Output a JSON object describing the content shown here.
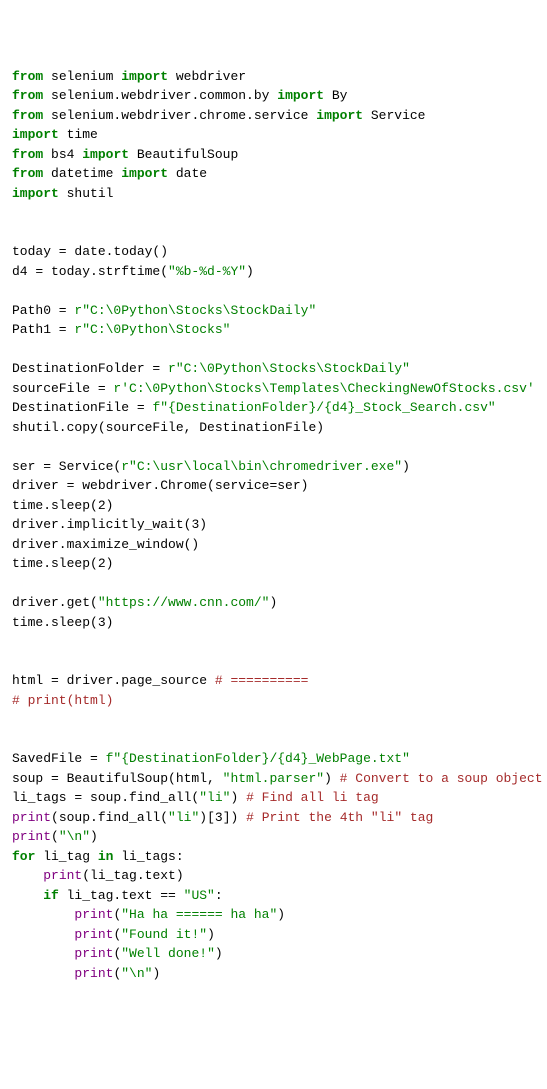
{
  "lines": [
    {
      "segments": [
        {
          "cls": "kw",
          "t": "from"
        },
        {
          "cls": "punct",
          "t": " selenium "
        },
        {
          "cls": "kw",
          "t": "import"
        },
        {
          "cls": "punct",
          "t": " webdriver"
        }
      ]
    },
    {
      "segments": [
        {
          "cls": "kw",
          "t": "from"
        },
        {
          "cls": "punct",
          "t": " selenium.webdriver.common.by "
        },
        {
          "cls": "kw",
          "t": "import"
        },
        {
          "cls": "punct",
          "t": " By"
        }
      ]
    },
    {
      "segments": [
        {
          "cls": "kw",
          "t": "from"
        },
        {
          "cls": "punct",
          "t": " selenium.webdriver.chrome.service "
        },
        {
          "cls": "kw",
          "t": "import"
        },
        {
          "cls": "punct",
          "t": " Service"
        }
      ]
    },
    {
      "segments": [
        {
          "cls": "kw",
          "t": "import"
        },
        {
          "cls": "punct",
          "t": " time"
        }
      ]
    },
    {
      "segments": [
        {
          "cls": "kw",
          "t": "from"
        },
        {
          "cls": "punct",
          "t": " bs4 "
        },
        {
          "cls": "kw",
          "t": "import"
        },
        {
          "cls": "punct",
          "t": " BeautifulSoup"
        }
      ]
    },
    {
      "segments": [
        {
          "cls": "kw",
          "t": "from"
        },
        {
          "cls": "punct",
          "t": " datetime "
        },
        {
          "cls": "kw",
          "t": "import"
        },
        {
          "cls": "punct",
          "t": " date"
        }
      ]
    },
    {
      "segments": [
        {
          "cls": "kw",
          "t": "import"
        },
        {
          "cls": "punct",
          "t": " shutil"
        }
      ]
    },
    {
      "segments": [
        {
          "cls": "punct",
          "t": ""
        }
      ]
    },
    {
      "segments": [
        {
          "cls": "punct",
          "t": ""
        }
      ]
    },
    {
      "segments": [
        {
          "cls": "punct",
          "t": "today = date.today()"
        }
      ]
    },
    {
      "segments": [
        {
          "cls": "punct",
          "t": "d4 = today.strftime("
        },
        {
          "cls": "str",
          "t": "\"%b-%d-%Y\""
        },
        {
          "cls": "punct",
          "t": ")"
        }
      ]
    },
    {
      "segments": [
        {
          "cls": "punct",
          "t": ""
        }
      ]
    },
    {
      "segments": [
        {
          "cls": "punct",
          "t": "Path0 = "
        },
        {
          "cls": "str",
          "t": "r\"C:\\0Python\\Stocks\\StockDaily\""
        }
      ]
    },
    {
      "segments": [
        {
          "cls": "punct",
          "t": "Path1 = "
        },
        {
          "cls": "str",
          "t": "r\"C:\\0Python\\Stocks\""
        }
      ]
    },
    {
      "segments": [
        {
          "cls": "punct",
          "t": ""
        }
      ]
    },
    {
      "segments": [
        {
          "cls": "punct",
          "t": "DestinationFolder = "
        },
        {
          "cls": "str",
          "t": "r\"C:\\0Python\\Stocks\\StockDaily\""
        }
      ]
    },
    {
      "segments": [
        {
          "cls": "punct",
          "t": "sourceFile = "
        },
        {
          "cls": "str",
          "t": "r'C:\\0Python\\Stocks\\Templates\\CheckingNewOfStocks.csv'"
        }
      ]
    },
    {
      "segments": [
        {
          "cls": "punct",
          "t": "DestinationFile = "
        },
        {
          "cls": "str",
          "t": "f\"{DestinationFolder}/{d4}_Stock_Search.csv\""
        }
      ]
    },
    {
      "segments": [
        {
          "cls": "punct",
          "t": "shutil.copy(sourceFile, DestinationFile)"
        }
      ]
    },
    {
      "segments": [
        {
          "cls": "punct",
          "t": ""
        }
      ]
    },
    {
      "segments": [
        {
          "cls": "punct",
          "t": "ser = Service("
        },
        {
          "cls": "str",
          "t": "r\"C:\\usr\\local\\bin\\chromedriver.exe\""
        },
        {
          "cls": "punct",
          "t": ")"
        }
      ]
    },
    {
      "segments": [
        {
          "cls": "punct",
          "t": "driver = webdriver.Chrome(service=ser)"
        }
      ]
    },
    {
      "segments": [
        {
          "cls": "punct",
          "t": "time.sleep("
        },
        {
          "cls": "num",
          "t": "2"
        },
        {
          "cls": "punct",
          "t": ")"
        }
      ]
    },
    {
      "segments": [
        {
          "cls": "punct",
          "t": "driver.implicitly_wait("
        },
        {
          "cls": "num",
          "t": "3"
        },
        {
          "cls": "punct",
          "t": ")"
        }
      ]
    },
    {
      "segments": [
        {
          "cls": "punct",
          "t": "driver.maximize_window()"
        }
      ]
    },
    {
      "segments": [
        {
          "cls": "punct",
          "t": "time.sleep("
        },
        {
          "cls": "num",
          "t": "2"
        },
        {
          "cls": "punct",
          "t": ")"
        }
      ]
    },
    {
      "segments": [
        {
          "cls": "punct",
          "t": ""
        }
      ]
    },
    {
      "segments": [
        {
          "cls": "punct",
          "t": "driver.get("
        },
        {
          "cls": "str",
          "t": "\"https://www.cnn.com/\""
        },
        {
          "cls": "punct",
          "t": ")"
        }
      ]
    },
    {
      "segments": [
        {
          "cls": "punct",
          "t": "time.sleep("
        },
        {
          "cls": "num",
          "t": "3"
        },
        {
          "cls": "punct",
          "t": ")"
        }
      ]
    },
    {
      "segments": [
        {
          "cls": "punct",
          "t": ""
        }
      ]
    },
    {
      "segments": [
        {
          "cls": "punct",
          "t": ""
        }
      ]
    },
    {
      "segments": [
        {
          "cls": "punct",
          "t": "html = driver.page_source "
        },
        {
          "cls": "comment-red",
          "t": "# =========="
        }
      ]
    },
    {
      "segments": [
        {
          "cls": "comment-red",
          "t": "# print(html)"
        }
      ]
    },
    {
      "segments": [
        {
          "cls": "punct",
          "t": ""
        }
      ]
    },
    {
      "segments": [
        {
          "cls": "punct",
          "t": ""
        }
      ]
    },
    {
      "segments": [
        {
          "cls": "punct",
          "t": "SavedFile = "
        },
        {
          "cls": "str",
          "t": "f\"{DestinationFolder}/{d4}_WebPage.txt\""
        }
      ]
    },
    {
      "segments": [
        {
          "cls": "punct",
          "t": "soup = BeautifulSoup(html, "
        },
        {
          "cls": "str",
          "t": "\"html.parser\""
        },
        {
          "cls": "punct",
          "t": ") "
        },
        {
          "cls": "comment-red",
          "t": "# Convert to a soup object"
        }
      ]
    },
    {
      "segments": [
        {
          "cls": "punct",
          "t": "li_tags = soup.find_all("
        },
        {
          "cls": "str",
          "t": "\"li\""
        },
        {
          "cls": "punct",
          "t": ") "
        },
        {
          "cls": "comment-red",
          "t": "# Find all li tag"
        }
      ]
    },
    {
      "segments": [
        {
          "cls": "magenta",
          "t": "print"
        },
        {
          "cls": "punct",
          "t": "(soup.find_all("
        },
        {
          "cls": "str",
          "t": "\"li\""
        },
        {
          "cls": "punct",
          "t": ")["
        },
        {
          "cls": "num",
          "t": "3"
        },
        {
          "cls": "punct",
          "t": "]) "
        },
        {
          "cls": "comment-red",
          "t": "# Print the 4th \"li\" tag"
        }
      ]
    },
    {
      "segments": [
        {
          "cls": "magenta",
          "t": "print"
        },
        {
          "cls": "punct",
          "t": "("
        },
        {
          "cls": "str",
          "t": "\"\\n\""
        },
        {
          "cls": "punct",
          "t": ")"
        }
      ]
    },
    {
      "segments": [
        {
          "cls": "kw",
          "t": "for"
        },
        {
          "cls": "punct",
          "t": " li_tag "
        },
        {
          "cls": "kw",
          "t": "in"
        },
        {
          "cls": "punct",
          "t": " li_tags:"
        }
      ]
    },
    {
      "segments": [
        {
          "cls": "punct",
          "t": "    "
        },
        {
          "cls": "magenta",
          "t": "print"
        },
        {
          "cls": "punct",
          "t": "(li_tag.text)"
        }
      ]
    },
    {
      "segments": [
        {
          "cls": "punct",
          "t": "    "
        },
        {
          "cls": "kw",
          "t": "if"
        },
        {
          "cls": "punct",
          "t": " li_tag.text == "
        },
        {
          "cls": "str",
          "t": "\"US\""
        },
        {
          "cls": "punct",
          "t": ":"
        }
      ]
    },
    {
      "segments": [
        {
          "cls": "punct",
          "t": "        "
        },
        {
          "cls": "magenta",
          "t": "print"
        },
        {
          "cls": "punct",
          "t": "("
        },
        {
          "cls": "str",
          "t": "\"Ha ha ====== ha ha\""
        },
        {
          "cls": "punct",
          "t": ")"
        }
      ]
    },
    {
      "segments": [
        {
          "cls": "punct",
          "t": "        "
        },
        {
          "cls": "magenta",
          "t": "print"
        },
        {
          "cls": "punct",
          "t": "("
        },
        {
          "cls": "str",
          "t": "\"Found it!\""
        },
        {
          "cls": "punct",
          "t": ")"
        }
      ]
    },
    {
      "segments": [
        {
          "cls": "punct",
          "t": "        "
        },
        {
          "cls": "magenta",
          "t": "print"
        },
        {
          "cls": "punct",
          "t": "("
        },
        {
          "cls": "str",
          "t": "\"Well done!\""
        },
        {
          "cls": "punct",
          "t": ")"
        }
      ]
    },
    {
      "segments": [
        {
          "cls": "punct",
          "t": "        "
        },
        {
          "cls": "magenta",
          "t": "print"
        },
        {
          "cls": "punct",
          "t": "("
        },
        {
          "cls": "str",
          "t": "\"\\n\""
        },
        {
          "cls": "punct",
          "t": ")"
        }
      ]
    }
  ]
}
